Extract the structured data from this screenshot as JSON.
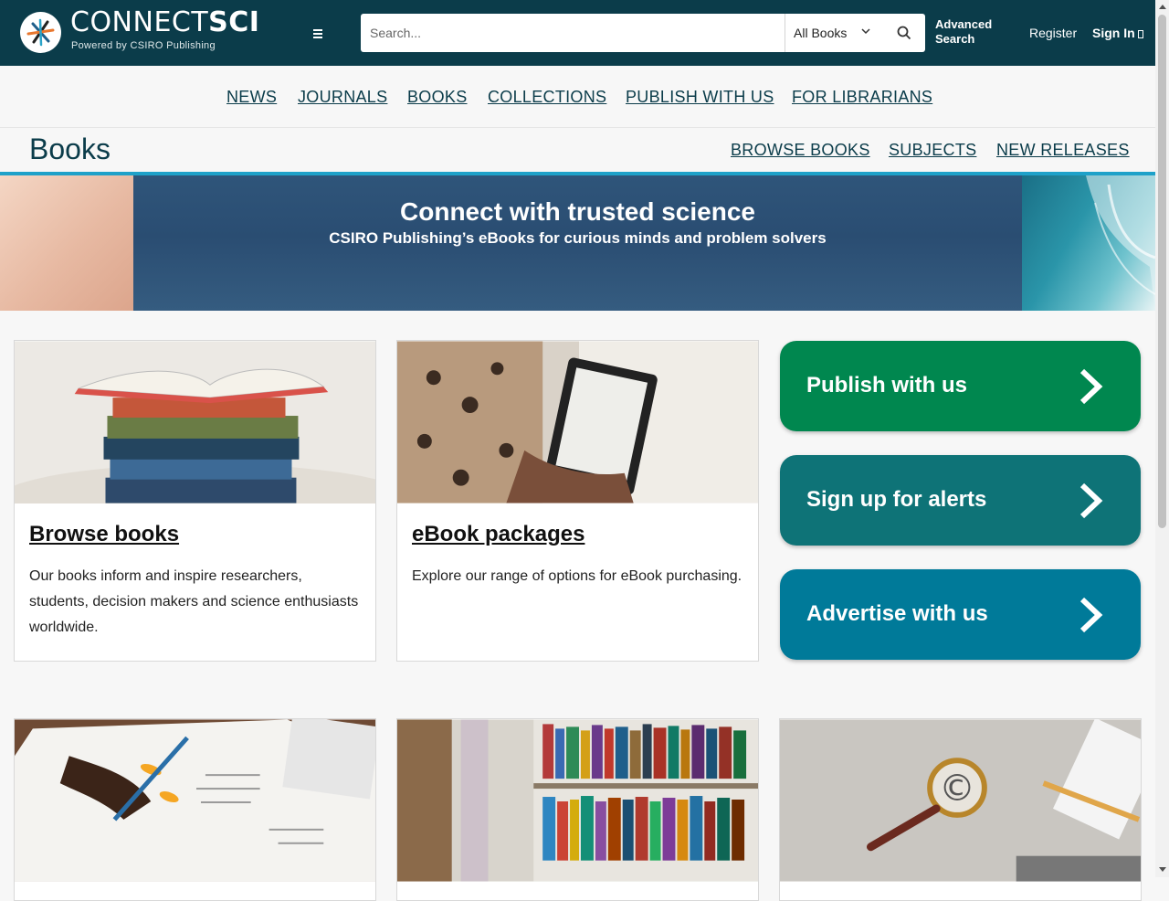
{
  "header": {
    "logo_light": "CONNECT",
    "logo_bold": "SCI",
    "logo_sub": "Powered by CSIRO Publishing",
    "search_placeholder": "Search...",
    "search_scope": "All Books",
    "advanced_search": "Advanced Search",
    "register": "Register",
    "sign_in": "Sign In"
  },
  "main_nav": [
    "NEWS",
    "JOURNALS",
    "BOOKS",
    "COLLECTIONS",
    "PUBLISH WITH US",
    "FOR LIBRARIANS"
  ],
  "section": {
    "title": "Books",
    "sub_nav": [
      "BROWSE BOOKS",
      "SUBJECTS",
      "NEW RELEASES"
    ]
  },
  "banner": {
    "title": "Connect with trusted science",
    "subtitle": "CSIRO Publishing’s eBooks for curious minds and problem solvers"
  },
  "cards": [
    {
      "title": "Browse books",
      "body": "Our books inform and inspire researchers, students, decision makers and science enthusiasts worldwide."
    },
    {
      "title": "eBook packages",
      "body": "Explore our range of options for eBook purchasing."
    }
  ],
  "promos": [
    {
      "label": "Publish with us",
      "color": "#00874f"
    },
    {
      "label": "Sign up for alerts",
      "color": "#0e7377"
    },
    {
      "label": "Advertise with us",
      "color": "#007a99"
    }
  ],
  "colors": {
    "header_bg": "#0b3c4a",
    "accent_rule": "#1ea1c9"
  }
}
